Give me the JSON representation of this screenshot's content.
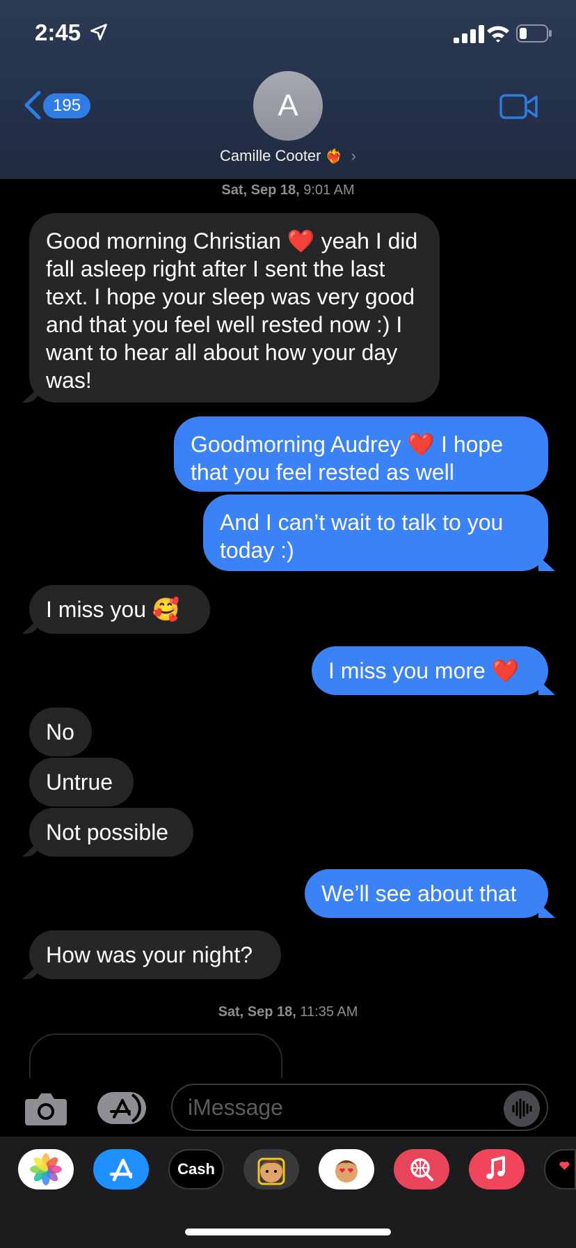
{
  "status_bar": {
    "time": "2:45"
  },
  "header": {
    "back_count": "195",
    "avatar_initial": "A",
    "contact_name": "Camille Cooter",
    "contact_emoji": "❤️‍🔥"
  },
  "timestamps": [
    {
      "day": "Sat, Sep 18,",
      "time": "9:01 AM"
    },
    {
      "day": "Sat, Sep 18,",
      "time": "11:35 AM"
    }
  ],
  "messages": [
    {
      "dir": "in",
      "text": "Good morning Christian ❤️ yeah I did fall asleep right after I sent the last text. I hope your sleep was very good and that you feel well rested now :) I want to hear all about how your day was!"
    },
    {
      "dir": "out",
      "text": "Goodmorning Audrey ❤️ I hope that you feel rested as well"
    },
    {
      "dir": "out",
      "text": "And I can’t wait to talk to you today :)"
    },
    {
      "dir": "in",
      "text": "I miss you 🥰"
    },
    {
      "dir": "out",
      "text": "I miss you more ❤️"
    },
    {
      "dir": "in",
      "text": "No"
    },
    {
      "dir": "in",
      "text": "Untrue"
    },
    {
      "dir": "in",
      "text": "Not possible"
    },
    {
      "dir": "out",
      "text": "We’ll see about that"
    },
    {
      "dir": "in",
      "text": "How was your night?"
    }
  ],
  "input": {
    "placeholder": "iMessage"
  },
  "tray": {
    "cash_label": "Cash",
    "apps": [
      "photos-icon",
      "app-store-icon",
      "apple-cash-icon",
      "memoji-icon",
      "memoji-stickers-icon",
      "images-search-icon",
      "music-icon",
      "digital-touch-icon"
    ]
  },
  "colors": {
    "outgoing": "#3b82f6",
    "incoming": "#262629",
    "accent": "#2f7de3"
  }
}
